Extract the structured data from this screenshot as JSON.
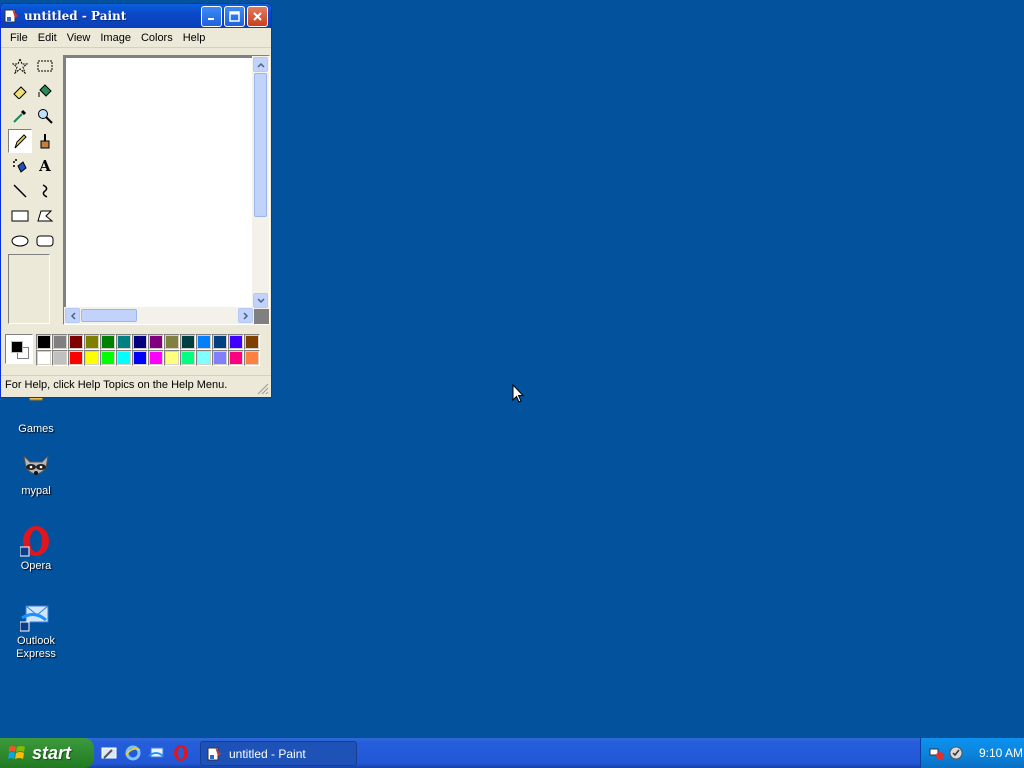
{
  "desktop": {
    "icons": [
      {
        "label": "Games"
      },
      {
        "label": "mypal"
      },
      {
        "label": "Opera"
      },
      {
        "label": "Outlook Express"
      }
    ]
  },
  "paint": {
    "title": "untitled - Paint",
    "menu": [
      "File",
      "Edit",
      "View",
      "Image",
      "Colors",
      "Help"
    ],
    "tools": [
      "free-form-select",
      "select",
      "eraser",
      "fill",
      "pick-color",
      "magnifier",
      "pencil",
      "brush",
      "airbrush",
      "text",
      "line",
      "curve",
      "rectangle",
      "polygon",
      "ellipse",
      "rounded-rectangle"
    ],
    "active_tool": "pencil",
    "text_tool_glyph": "A",
    "foreground_color": "#000000",
    "background_color": "#ffffff",
    "palette_row1": [
      "#000000",
      "#808080",
      "#800000",
      "#808000",
      "#008000",
      "#008080",
      "#000080",
      "#800080",
      "#808040",
      "#004040",
      "#0080ff",
      "#004080",
      "#4000ff",
      "#804000"
    ],
    "palette_row2": [
      "#ffffff",
      "#c0c0c0",
      "#ff0000",
      "#ffff00",
      "#00ff00",
      "#00ffff",
      "#0000ff",
      "#ff00ff",
      "#ffff80",
      "#00ff80",
      "#80ffff",
      "#8080ff",
      "#ff0080",
      "#ff8040"
    ],
    "status": "For Help, click Help Topics on the Help Menu."
  },
  "taskbar": {
    "start_label": "start",
    "task_label": "untitled - Paint",
    "clock": "9:10 AM"
  }
}
